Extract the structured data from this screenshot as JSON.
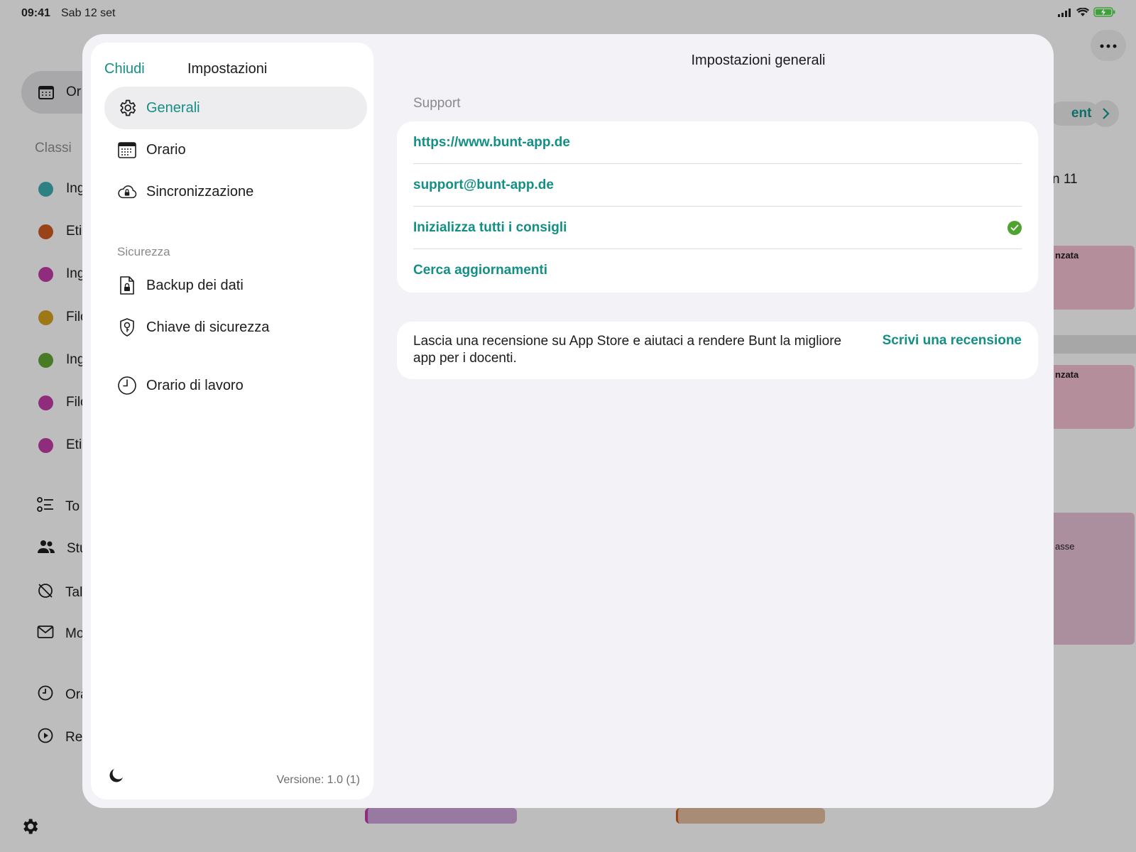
{
  "status_bar": {
    "time": "09:41",
    "date": "Sab 12 set"
  },
  "background": {
    "pill_label": "Or",
    "section_classes": "Classi",
    "classes": [
      {
        "label": "Ing",
        "color": "#3aa6a8"
      },
      {
        "label": "Eti",
        "color": "#c4561f"
      },
      {
        "label": "Ing",
        "color": "#b8399f"
      },
      {
        "label": "Filo",
        "color": "#c99a1e"
      },
      {
        "label": "Ing",
        "color": "#5e9e33"
      },
      {
        "label": "Filo",
        "color": "#b8399f"
      },
      {
        "label": "Eti",
        "color": "#b8399f"
      }
    ],
    "nav": [
      {
        "label": "To",
        "icon": "checklist-icon"
      },
      {
        "label": "Stu",
        "icon": "people-icon"
      },
      {
        "label": "Tal",
        "icon": "timer-off-icon"
      },
      {
        "label": "Mo",
        "icon": "mail-icon"
      },
      {
        "label": "Ora",
        "icon": "clock-icon"
      },
      {
        "label": "Re",
        "icon": "play-circle-icon"
      }
    ],
    "next_label": "ente",
    "day_label": "n 11",
    "events": [
      "nzata",
      "nzata",
      "asse"
    ]
  },
  "settings": {
    "close_label": "Chiudi",
    "title": "Impostazioni",
    "menu": [
      {
        "label": "Generali",
        "icon": "gear-icon",
        "active": true
      },
      {
        "label": "Orario",
        "icon": "calendar-icon"
      },
      {
        "label": "Sincronizzazione",
        "icon": "cloud-lock-icon"
      }
    ],
    "security_section": "Sicurezza",
    "security_menu": [
      {
        "label": "Backup dei dati",
        "icon": "file-lock-icon"
      },
      {
        "label": "Chiave di sicurezza",
        "icon": "shield-key-icon"
      }
    ],
    "work_menu": [
      {
        "label": "Orario di lavoro",
        "icon": "clock-icon"
      }
    ],
    "version": "Versione: 1.0 (1)"
  },
  "general": {
    "title": "Impostazioni generali",
    "support_label": "Support",
    "rows": [
      {
        "label": "https://www.bunt-app.de"
      },
      {
        "label": "support@bunt-app.de"
      },
      {
        "label": "Inizializza tutti i consigli",
        "checked": true
      },
      {
        "label": "Cerca aggiornamenti"
      }
    ],
    "review_text": "Lascia una recensione su App Store e aiutaci a rendere Bunt la migliore app per i docenti.",
    "review_link": "Scrivi una recensione"
  },
  "colors": {
    "accent": "#148f86",
    "check": "#4fa32f"
  }
}
